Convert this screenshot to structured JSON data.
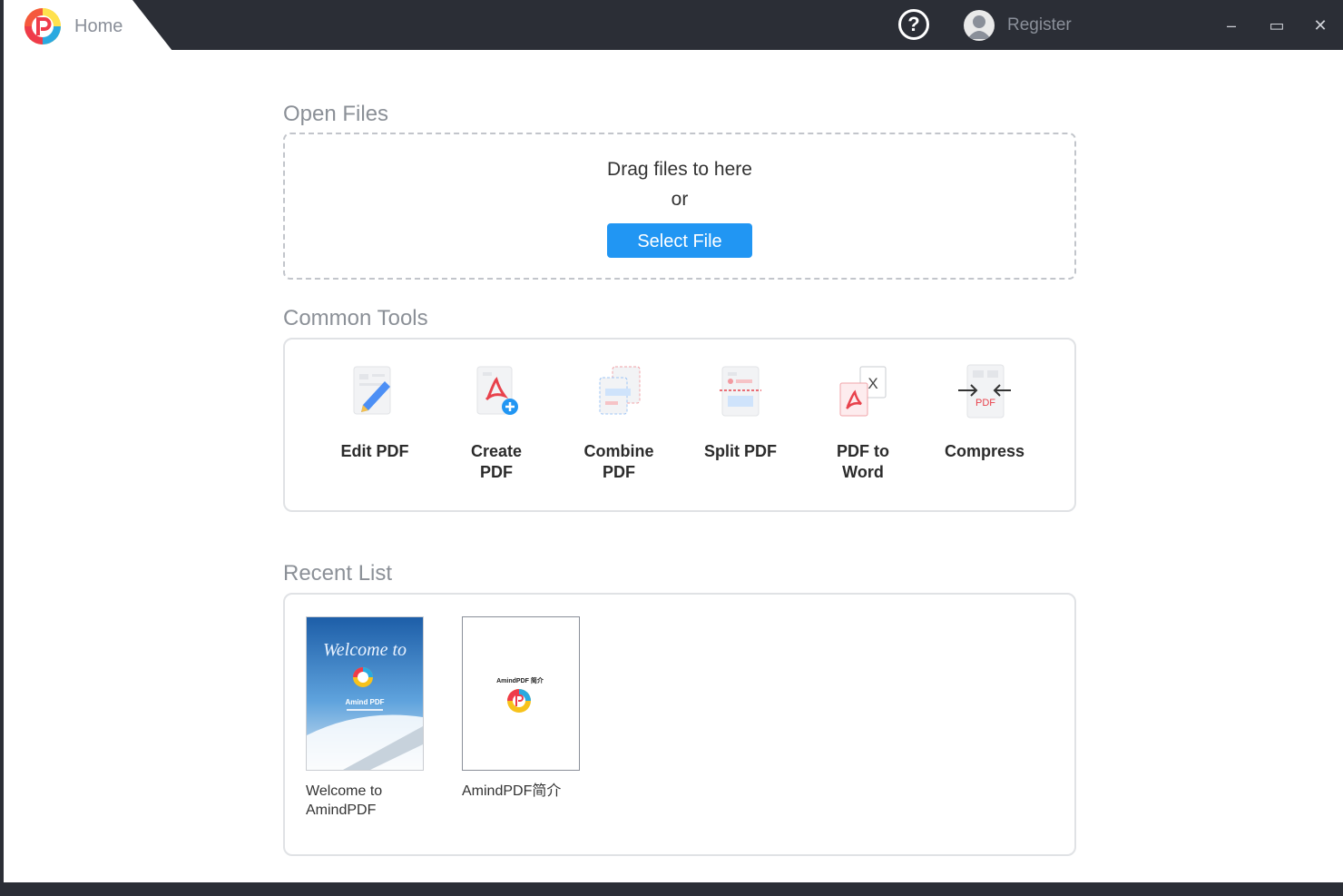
{
  "topbar": {
    "tab_label": "Home",
    "help_glyph": "?",
    "register_label": "Register",
    "window_controls": [
      "–",
      "▭",
      "✕"
    ]
  },
  "open_files": {
    "title": "Open Files",
    "drag_text": "Drag files to here",
    "or_text": "or",
    "select_button": "Select File"
  },
  "common_tools": {
    "title": "Common Tools",
    "tools": [
      {
        "label": "Edit PDF",
        "icon": "edit-pdf-icon"
      },
      {
        "label": "Create\nPDF",
        "icon": "create-pdf-icon"
      },
      {
        "label": "Combine\nPDF",
        "icon": "combine-pdf-icon"
      },
      {
        "label": "Split PDF",
        "icon": "split-pdf-icon"
      },
      {
        "label": "PDF to\nWord",
        "icon": "pdf-to-word-icon"
      },
      {
        "label": "Compress",
        "icon": "compress-icon"
      }
    ]
  },
  "recent_list": {
    "title": "Recent List",
    "items": [
      {
        "name": "Welcome to\nAmindPDF",
        "thumb_script": "Welcome to",
        "thumb_title": "Amind PDF"
      },
      {
        "name": "AmindPDF简介",
        "thumb_title": "AmindPDF 简介"
      }
    ]
  },
  "colors": {
    "accent": "#2196f3",
    "titlebar": "#2b2e36"
  }
}
